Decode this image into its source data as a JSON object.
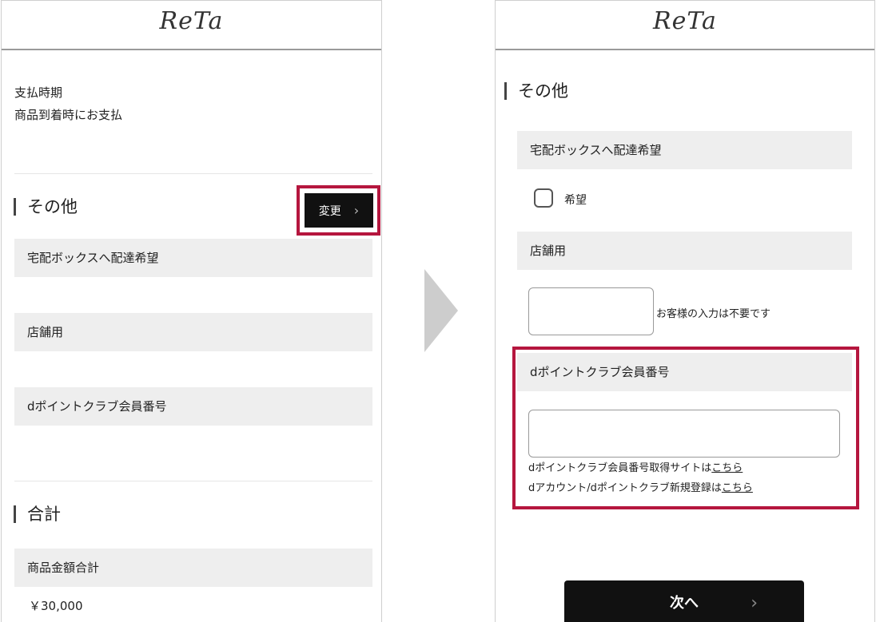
{
  "left": {
    "logo": "ReTa",
    "payment_timing_label": "支払時期",
    "payment_timing_value": "商品到着時にお支払",
    "other_section_title": "その他",
    "change_button_label": "変更",
    "delivery_box_label": "宅配ボックスへ配達希望",
    "store_use_label": "店舗用",
    "dpoint_label": "dポイントクラブ会員番号",
    "total_section_title": "合計",
    "subtotal_label": "商品金額合計",
    "subtotal_value": "￥30,000"
  },
  "right": {
    "logo": "ReTa",
    "other_section_title": "その他",
    "delivery_box_label": "宅配ボックスへ配達希望",
    "delivery_box_option": "希望",
    "store_use_label": "店舗用",
    "store_use_note": "お客様の入力は不要です",
    "dpoint_label": "dポイントクラブ会員番号",
    "dpoint_link_line1_prefix": "dポイントクラブ会員番号取得サイトは",
    "dpoint_link_line1_link": "こちら",
    "dpoint_link_line2_prefix": "dアカウント/dポイントクラブ新規登録は",
    "dpoint_link_line2_link": "こちら",
    "next_button_label": "次へ"
  },
  "colors": {
    "highlight": "#b5163e",
    "button_bg": "#111111",
    "bar_bg": "#eeeeee",
    "transition_arrow": "#cdcdcd"
  },
  "icons": {
    "chevron": "chevron-right-icon",
    "transition": "arrow-right-icon"
  }
}
